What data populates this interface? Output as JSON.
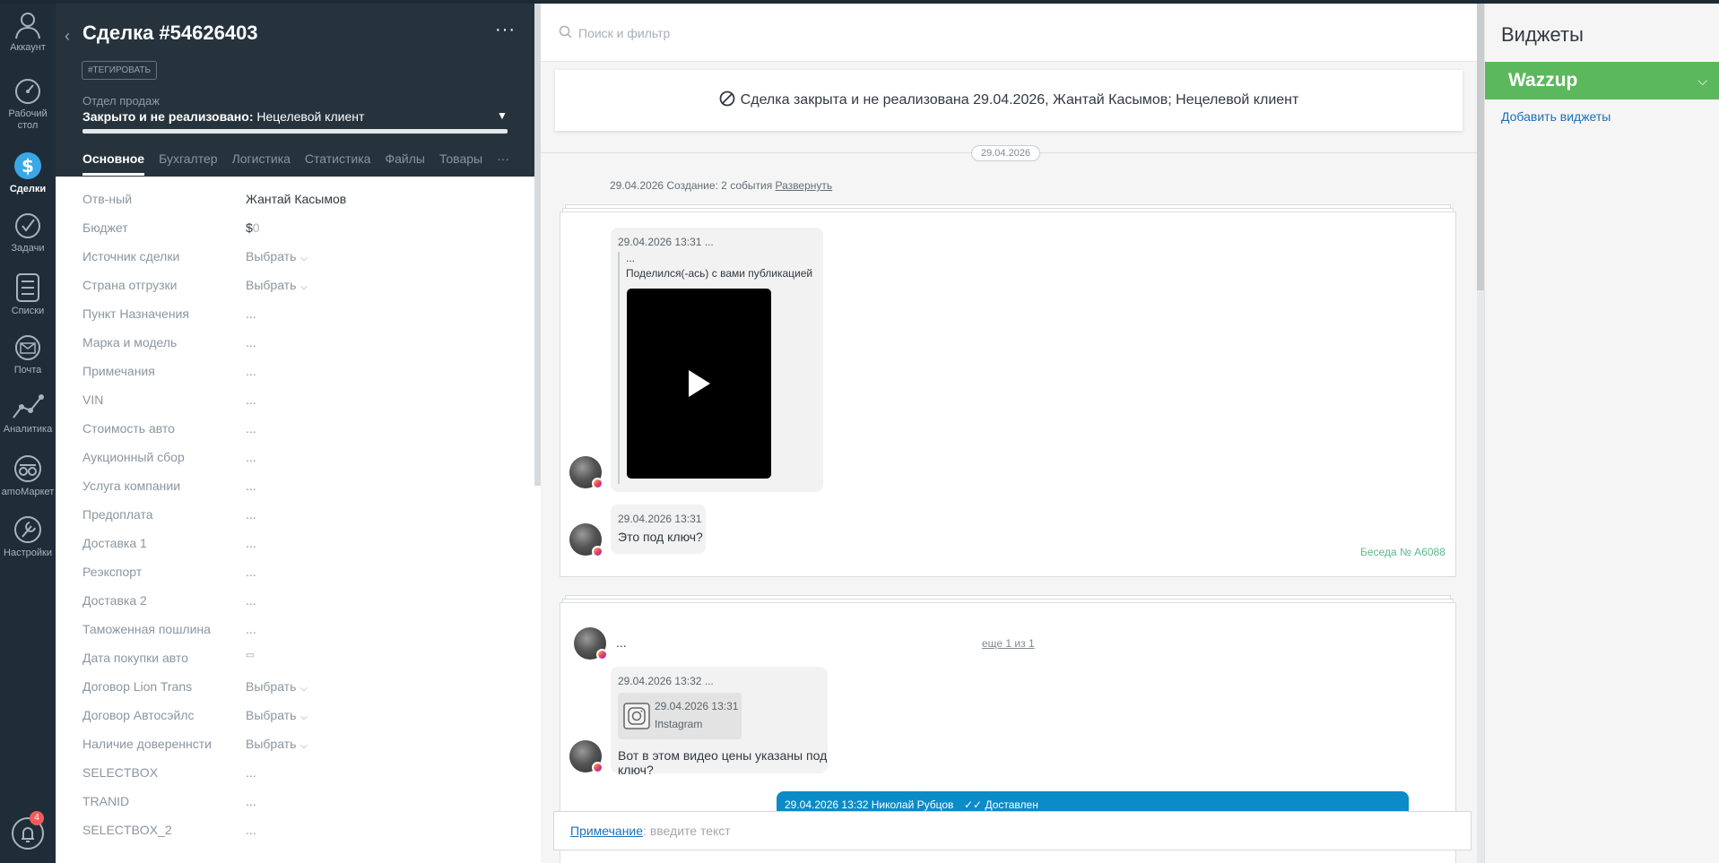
{
  "nav": {
    "items": [
      {
        "label": "Аккаунт"
      },
      {
        "label": "Рабочий стол"
      },
      {
        "label": "Сделки"
      },
      {
        "label": "Задачи"
      },
      {
        "label": "Списки"
      },
      {
        "label": "Почта"
      },
      {
        "label": "Аналитика"
      },
      {
        "label": "amoМаркет"
      },
      {
        "label": "Настройки"
      }
    ],
    "notifications_count": "4"
  },
  "card": {
    "title": "Сделка #54626403",
    "menu_label": "···",
    "tag_button": "#ТЕГИРОВАТЬ",
    "pipeline": "Отдел продаж",
    "status": "Закрыто и не реализовано:",
    "status_reason": "Нецелевой клиент",
    "tabs": [
      "Основное",
      "Бухгалтер",
      "Логистика",
      "Статистика",
      "Файлы",
      "Товары",
      "···"
    ],
    "fields": [
      {
        "name": "Отв-ный",
        "value": "Жантай Касымов"
      },
      {
        "name": "Бюджет",
        "value": "$",
        "zero": "0"
      },
      {
        "name": "Источник сделки",
        "value": "Выбрать"
      },
      {
        "name": "Страна отгрузки",
        "value": "Выбрать"
      },
      {
        "name": "Пункт Назначения",
        "value": "..."
      },
      {
        "name": "Марка и модель",
        "value": "..."
      },
      {
        "name": "Примечания",
        "value": "..."
      },
      {
        "name": "VIN",
        "value": "..."
      },
      {
        "name": "Стоимость авто",
        "value": "..."
      },
      {
        "name": "Аукционный сбор",
        "value": "..."
      },
      {
        "name": "Услуга компании",
        "value": "..."
      },
      {
        "name": "Предоплата",
        "value": "..."
      },
      {
        "name": "Доставка 1",
        "value": "..."
      },
      {
        "name": "Реэкспорт",
        "value": "..."
      },
      {
        "name": "Доставка 2",
        "value": "..."
      },
      {
        "name": "Таможенная пошлина",
        "value": "..."
      },
      {
        "name": "Дата покупки авто",
        "value": "▭"
      },
      {
        "name": "Договор Lion Trans",
        "value": "Выбрать"
      },
      {
        "name": "Договор Автосэйлс",
        "value": "Выбрать"
      },
      {
        "name": "Наличие довереннсти",
        "value": "Выбрать"
      },
      {
        "name": "SELECTBOX",
        "value": "..."
      },
      {
        "name": "TRANID",
        "value": "..."
      },
      {
        "name": "SELECTBOX_2",
        "value": "..."
      }
    ]
  },
  "feed": {
    "search_placeholder": "Поиск и фильтр",
    "closed_banner": "Сделка закрыта и не реализована 29.04.2026, Жантай Касымов; Нецелевой клиент",
    "date_pill": "29.04.2026",
    "created_text": "29.04.2026 Создание: 2 события",
    "expand_link": "Развернуть",
    "convo1": {
      "msg1_meta": "29.04.2026 13:31 ...",
      "msg1_ellipsis": "...",
      "msg1_text": "Поделился(-ась) с вами публикацией",
      "msg2_meta": "29.04.2026 13:31 ...",
      "msg2_text": "Это под ключ?",
      "conversation_no": "Беседа № A6088"
    },
    "convo2": {
      "header_ellipsis": "...",
      "more_link": "еще 1 из 1",
      "msg_meta": "29.04.2026 13:32 ...",
      "quote_meta": "29.04.2026 13:31 ...",
      "quote_source": "Instagram",
      "msg_text": "Вот в этом видео цены указаны под ключ?",
      "out_meta": "29.04.2026 13:32 Николай Рубцов",
      "out_status": "✓✓ Доставлен"
    },
    "note_link": "Примечание",
    "note_placeholder": ": введите текст"
  },
  "widgets": {
    "title": "Виджеты",
    "wazzup": "Wazzup",
    "add_link": "Добавить виджеты"
  }
}
